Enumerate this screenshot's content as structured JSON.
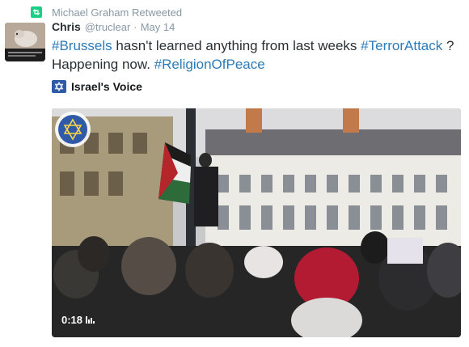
{
  "retweet": {
    "icon": "retweet-icon",
    "text": "Michael Graham Retweeted"
  },
  "tweet": {
    "author_name": "Chris",
    "handle": "@truclear",
    "separator": "·",
    "time": "May 14",
    "text_parts": [
      {
        "text": "#Brussels",
        "hashtag": true
      },
      {
        "text": " hasn't learned anything from last weeks ",
        "hashtag": false
      },
      {
        "text": "#TerrorAttack",
        "hashtag": true
      },
      {
        "text": " ?",
        "hashtag": false
      },
      {
        "text": "Happening now. ",
        "hashtag": false
      },
      {
        "text": "#ReligionOfPeace",
        "hashtag": true
      }
    ]
  },
  "card": {
    "source_name": "Israel's Voice",
    "source_icon": "star-of-david-icon",
    "video": {
      "duration": "0:18",
      "play_indicator": "volume-bars-icon"
    }
  },
  "colors": {
    "hashtag": "#2b7bb9",
    "meta": "#8899a6",
    "retweet_green": "#19cf86"
  }
}
